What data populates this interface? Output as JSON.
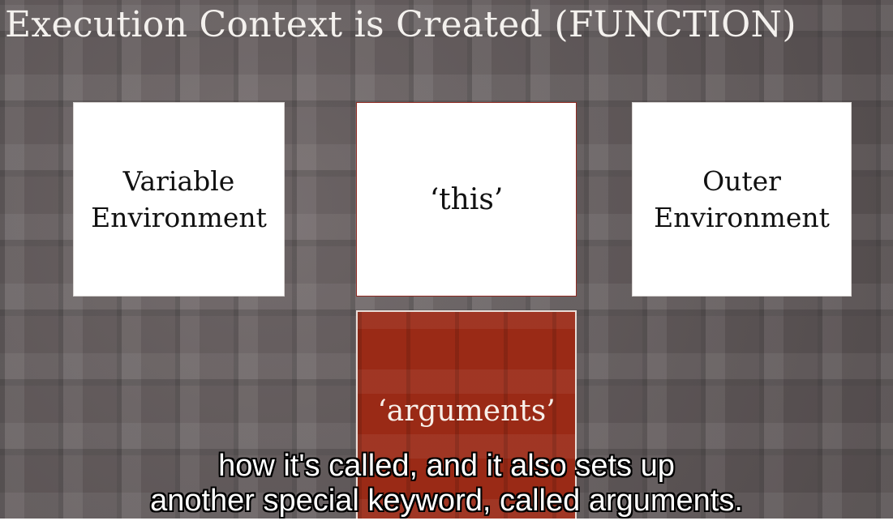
{
  "slide": {
    "title": "Execution Context is Created (FUNCTION)"
  },
  "boxes": {
    "variable_environment": {
      "line1": "Variable",
      "line2": "Environment"
    },
    "this": {
      "label": "‘this’"
    },
    "outer_environment": {
      "line1": "Outer",
      "line2": "Environment"
    },
    "arguments": {
      "label": "‘arguments’"
    }
  },
  "captions": [
    "how it's called, and it also sets up",
    "another special keyword, called arguments."
  ],
  "colors": {
    "background": "#5d5556",
    "box": "#ffffff",
    "arguments_box": "#9a2a16",
    "title_text": "#f4f1ee"
  }
}
